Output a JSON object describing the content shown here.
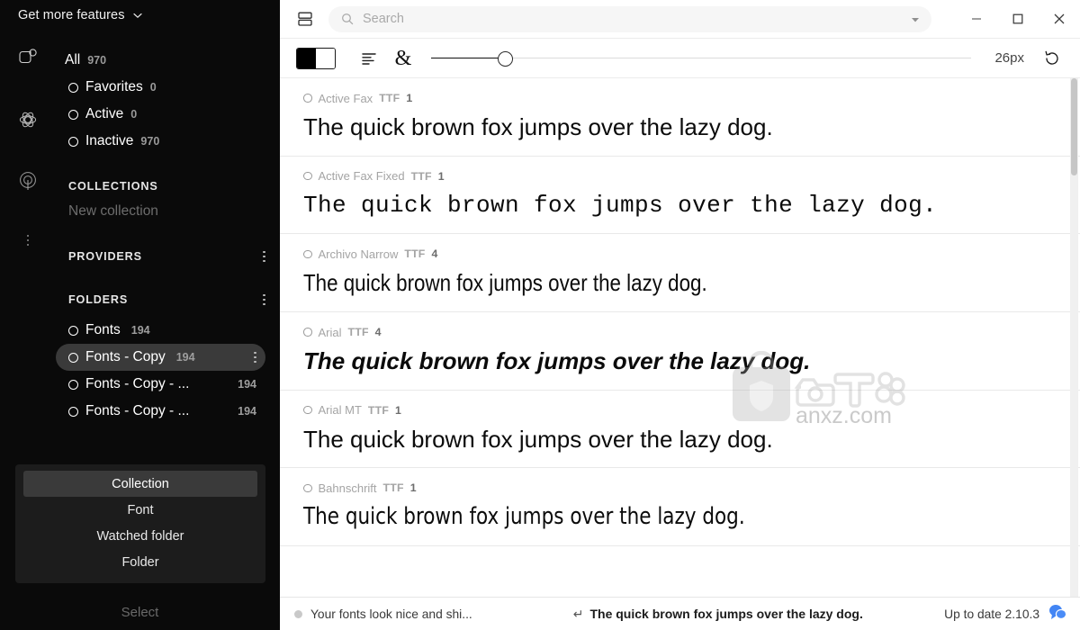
{
  "sidebar": {
    "header": {
      "label": "Get more features",
      "chevron": "chevron-down-icon"
    },
    "rail": [
      {
        "icon": "font-badge-icon"
      },
      {
        "icon": "atom-icon"
      },
      {
        "icon": "broadcast-icon"
      },
      {
        "icon": "more-vertical-icon"
      }
    ],
    "filters": [
      {
        "label": "All",
        "count": "970",
        "ring": false
      },
      {
        "label": "Favorites",
        "count": "0",
        "ring": true
      },
      {
        "label": "Active",
        "count": "0",
        "ring": true
      },
      {
        "label": "Inactive",
        "count": "970",
        "ring": true
      }
    ],
    "collections": {
      "title": "COLLECTIONS",
      "new_label": "New collection"
    },
    "providers": {
      "title": "PROVIDERS"
    },
    "folders": {
      "title": "FOLDERS",
      "items": [
        {
          "label": "Fonts",
          "count": "194",
          "selected": false
        },
        {
          "label": "Fonts - Copy",
          "count": "194",
          "selected": true
        },
        {
          "label": "Fonts - Copy - ...",
          "count": "194",
          "selected": false
        },
        {
          "label": "Fonts - Copy - ...",
          "count": "194",
          "selected": false
        }
      ]
    },
    "popup": {
      "items": [
        {
          "label": "Collection",
          "active": true
        },
        {
          "label": "Font",
          "active": false
        },
        {
          "label": "Watched folder",
          "active": false
        },
        {
          "label": "Folder",
          "active": false
        }
      ]
    },
    "select_label": "Select"
  },
  "titlebar": {
    "view_toggle_icon": "split-view-icon",
    "search": {
      "icon": "search-icon",
      "placeholder": "Search",
      "value": ""
    },
    "dropdown_icon": "caret-down-icon",
    "window": {
      "minimize": "minimize-icon",
      "maximize": "maximize-icon",
      "close": "close-icon"
    }
  },
  "toolbar": {
    "contrast_toggle": "black-white-contrast-icon",
    "align_icon": "text-align-left-icon",
    "glyph_icon": "ampersand-glyph-icon",
    "glyph_char": "&",
    "slider": {
      "value_percent": 12
    },
    "size_label": "26px",
    "reset_icon": "reset-rotate-icon"
  },
  "fonts": [
    {
      "name": "Active Fax",
      "format": "TTF",
      "count": "1",
      "sample": "The quick brown fox jumps over the lazy dog.",
      "style": "s-sans"
    },
    {
      "name": "Active Fax Fixed",
      "format": "TTF",
      "count": "1",
      "sample": "The quick brown fox jumps over the lazy dog.",
      "style": "s-mono"
    },
    {
      "name": "Archivo Narrow",
      "format": "TTF",
      "count": "4",
      "sample": "The quick brown fox jumps over the lazy dog.",
      "style": "s-narrow"
    },
    {
      "name": "Arial",
      "format": "TTF",
      "count": "4",
      "sample": "The quick brown fox jumps over the lazy dog.",
      "style": "s-bolditalic"
    },
    {
      "name": "Arial MT",
      "format": "TTF",
      "count": "1",
      "sample": "The quick brown fox jumps over the lazy dog.",
      "style": "s-sans"
    },
    {
      "name": "Bahnschrift",
      "format": "TTF",
      "count": "1",
      "sample": "The quick brown fox jumps over the lazy dog.",
      "style": "s-cond"
    }
  ],
  "statusbar": {
    "message": "Your fonts look nice and shi...",
    "enter_symbol": "↵",
    "preview_text": "The quick brown fox jumps over the lazy dog.",
    "update_label": "Up to date 2.10.3",
    "chat_icon": "chat-bubbles-icon"
  },
  "watermark": {
    "text": "anxz.com"
  },
  "colors": {
    "sidebar_bg": "#0a0a0a",
    "selected_row": "#3a3a3a",
    "popup_bg": "#1c1c1c",
    "accent_blue": "#4285f4",
    "text_muted": "#a4a4a4"
  }
}
